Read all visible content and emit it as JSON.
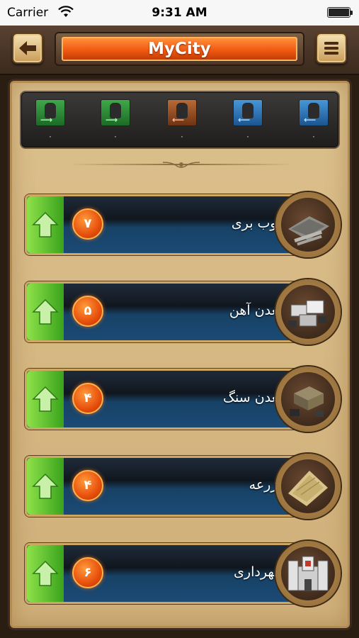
{
  "status_bar": {
    "carrier": "Carrier",
    "time": "9:31 AM"
  },
  "header": {
    "title": "MyCity",
    "back_icon": "arrow-left-icon",
    "menu_icon": "hamburger-menu-icon"
  },
  "troops": [
    {
      "icon": "green-outbound-soldier-icon",
      "count": "۰"
    },
    {
      "icon": "green-outbound-soldier-icon",
      "count": "۰"
    },
    {
      "icon": "orange-incoming-soldier-icon",
      "count": "۰"
    },
    {
      "icon": "blue-incoming-soldier-icon",
      "count": "۰"
    },
    {
      "icon": "blue-incoming-soldier-icon",
      "count": "۰"
    }
  ],
  "buildings": [
    {
      "name": "چوب بری",
      "level": "۷",
      "icon": "lumber-mill-icon"
    },
    {
      "name": "معدن آهن",
      "level": "۵",
      "icon": "iron-mine-icon"
    },
    {
      "name": "معدن سنگ",
      "level": "۴",
      "icon": "stone-mine-icon"
    },
    {
      "name": "مزرعه",
      "level": "۴",
      "icon": "farm-icon"
    },
    {
      "name": "شهرداری",
      "level": "۶",
      "icon": "town-hall-icon"
    }
  ],
  "colors": {
    "title_orange": "#f05a12",
    "upgrade_green": "#3aa31c",
    "level_orange": "#e74f0c",
    "row_blue": "#1b4a75",
    "panel_parchment": "#d6b985"
  }
}
